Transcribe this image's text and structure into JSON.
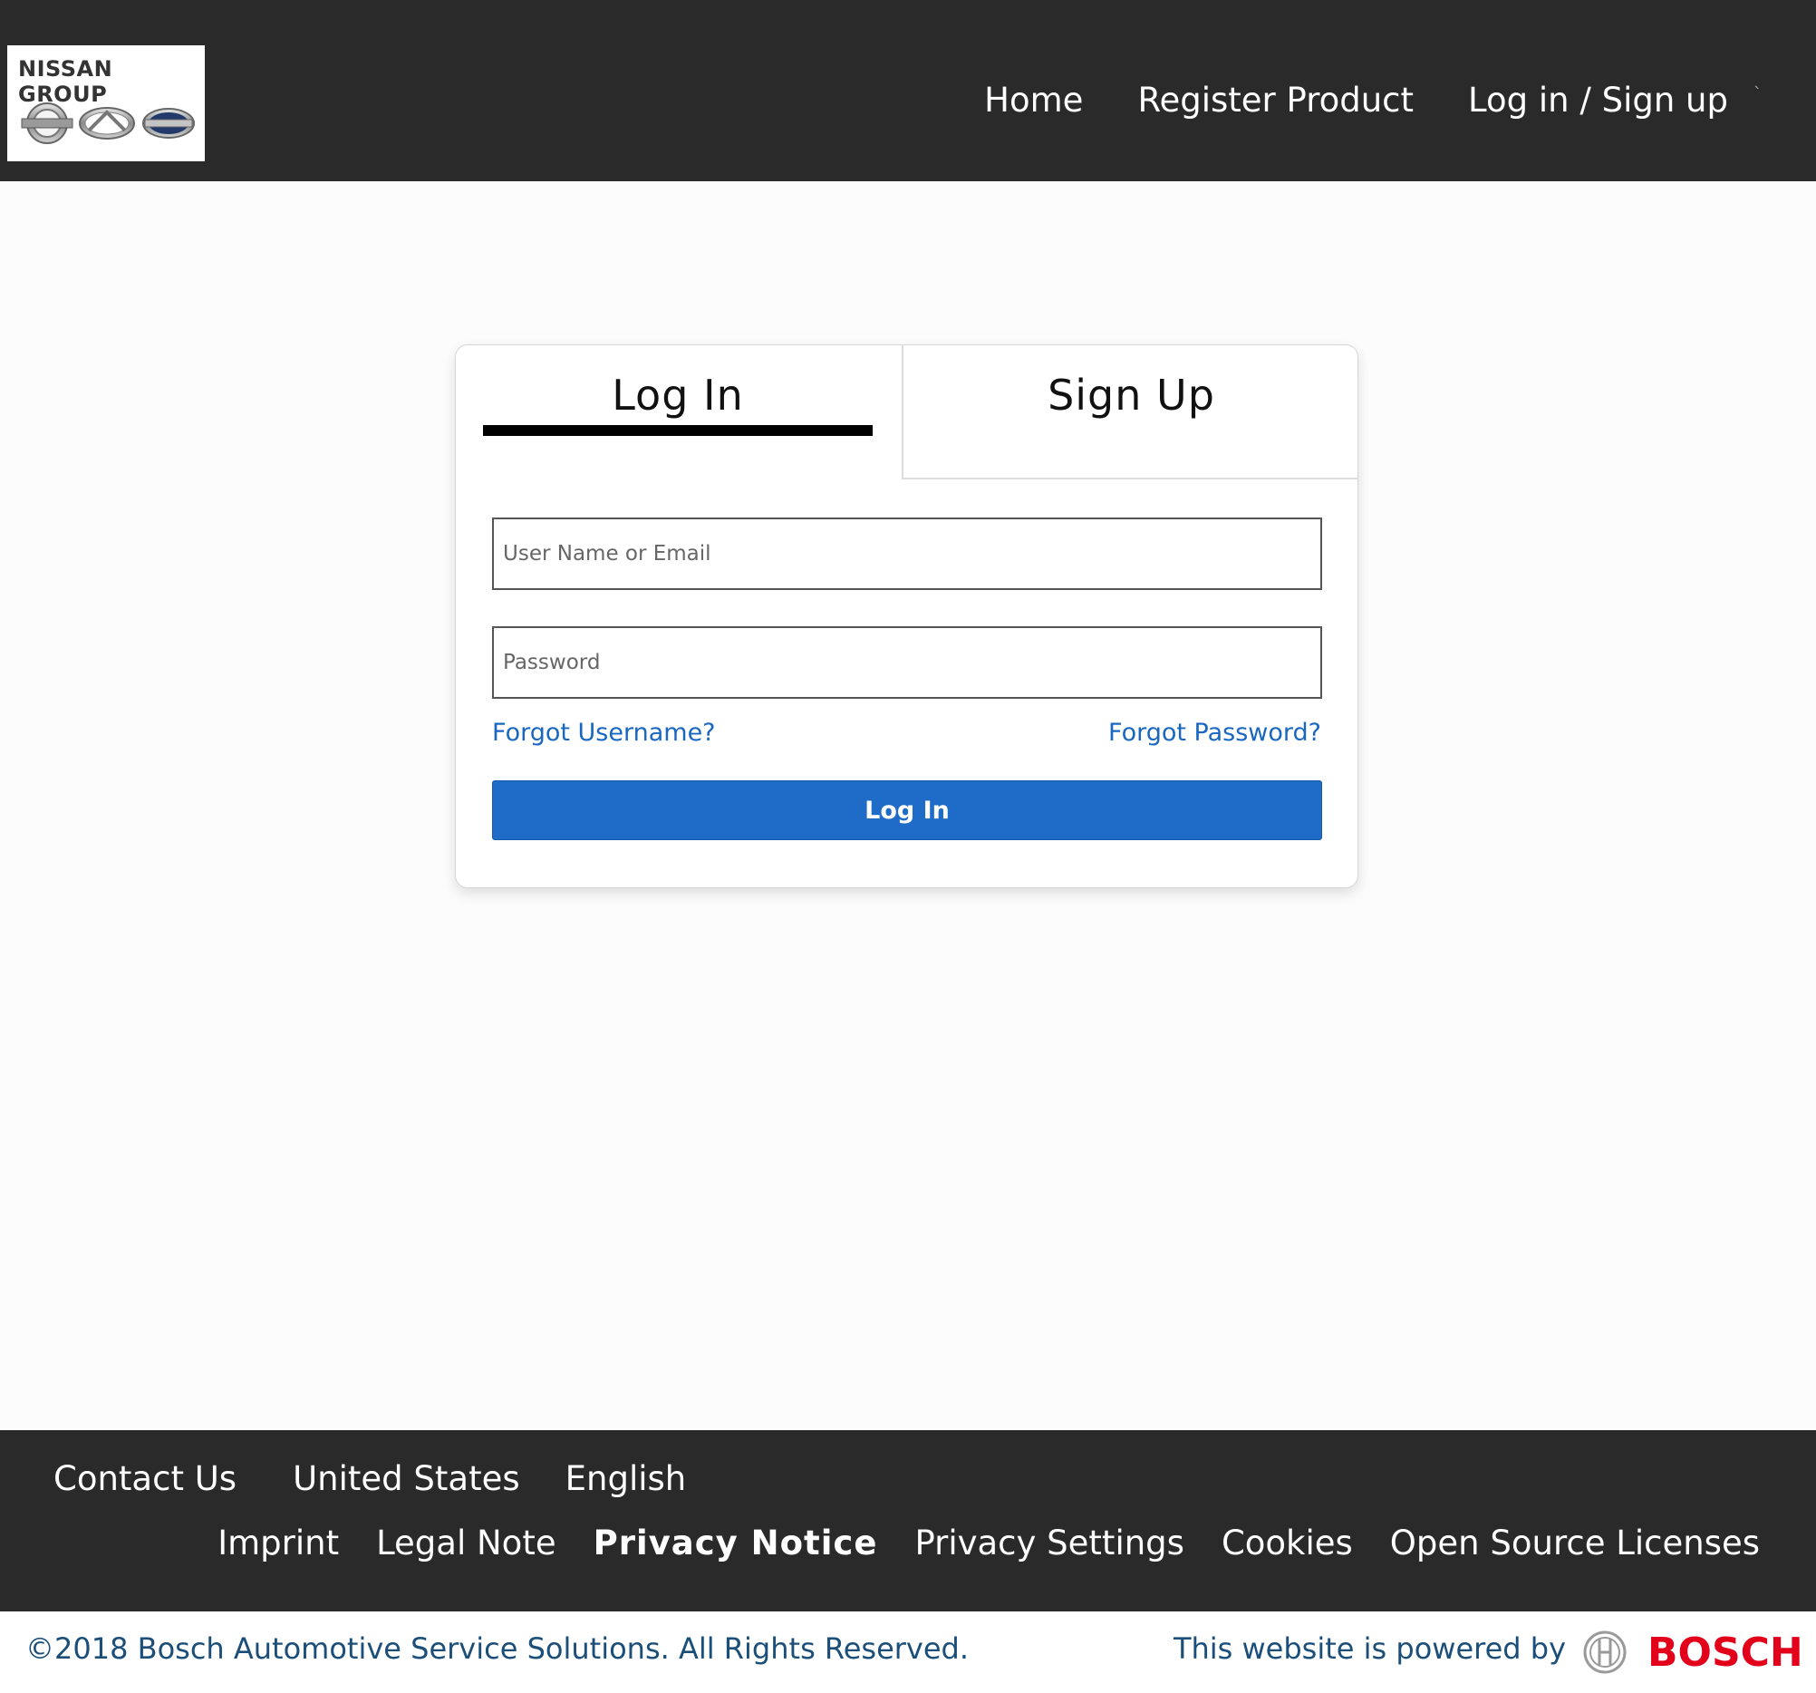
{
  "header": {
    "logo_text": "NISSAN GROUP",
    "logo_emblems": [
      "NISSAN",
      "INFINITI",
      "DATSUN"
    ],
    "nav": {
      "home": "Home",
      "register_product": "Register Product",
      "login_signup": "Log in / Sign up"
    }
  },
  "card": {
    "tabs": {
      "login": "Log In",
      "signup": "Sign Up"
    },
    "username_placeholder": "User Name or Email",
    "password_placeholder": "Password",
    "forgot_username": "Forgot Username?",
    "forgot_password": "Forgot Password?",
    "login_button": "Log In"
  },
  "footer": {
    "row1": {
      "contact": "Contact Us",
      "country": "United States",
      "language": "English"
    },
    "row2": {
      "imprint": "Imprint",
      "legal_note": "Legal Note",
      "privacy_notice": "Privacy Notice",
      "privacy_settings": "Privacy Settings",
      "cookies": "Cookies",
      "open_source": "Open Source Licenses"
    }
  },
  "bottom": {
    "copyright": "©2018 Bosch Automotive Service Solutions. All Rights Reserved.",
    "powered_by": "This website is powered by",
    "brand": "BOSCH"
  },
  "colors": {
    "header_bg": "#2a2a2a",
    "link": "#1a67c2",
    "primary_button": "#1e6cc8",
    "bottom_text": "#1b4f7a",
    "bosch_red": "#e2001a"
  },
  "icons": {
    "bosch_logo": "bosch-armature-icon"
  }
}
